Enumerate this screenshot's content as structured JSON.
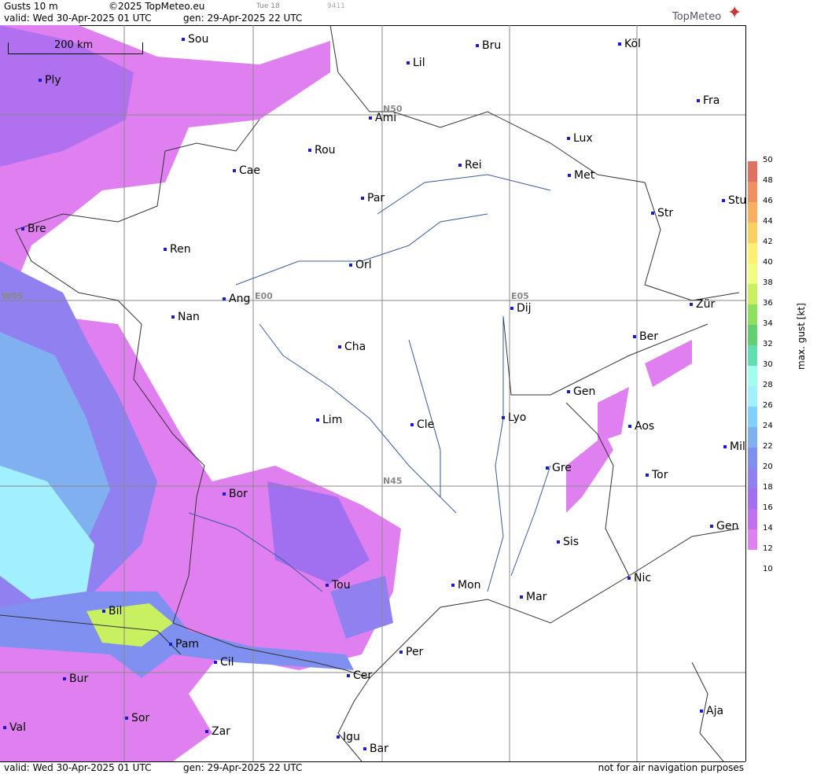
{
  "header": {
    "product": "Gusts 10 m",
    "copyright": "©2025 TopMeteo.eu",
    "model_run_tag": "Tue 18",
    "code": "9411",
    "valid": "valid:  Wed  30-Apr-2025  01 UTC",
    "gen": "gen:  29-Apr-2025  22 UTC",
    "logo_text": "TopMeteo"
  },
  "scale_bar": {
    "label": "200 km"
  },
  "grid_labels": [
    "N50",
    "W05",
    "E00",
    "E05",
    "N45"
  ],
  "cities": [
    "Sou",
    "Bru",
    "Köl",
    "Lil",
    "Ply",
    "Ami",
    "Fra",
    "Lux",
    "Rou",
    "Cae",
    "Rei",
    "Met",
    "Par",
    "Stu",
    "Bre",
    "Str",
    "Ren",
    "Orl",
    "Ang",
    "Dij",
    "Zür",
    "Nan",
    "Ber",
    "Cha",
    "Gen",
    "Lim",
    "Cle",
    "Lyo",
    "Aos",
    "Mil",
    "Gre",
    "Tor",
    "Bor",
    "Gen",
    "Sis",
    "Nic",
    "Tou",
    "Mon",
    "Mar",
    "Bil",
    "Per",
    "Pam",
    "Cil",
    "Cer",
    "Bur",
    "Aja",
    "Sor",
    "Val",
    "Zar",
    "Igu",
    "Bar"
  ],
  "legend": {
    "title": "max. gust  [kt]",
    "ticks": [
      "50",
      "48",
      "46",
      "44",
      "42",
      "40",
      "38",
      "36",
      "34",
      "32",
      "30",
      "28",
      "26",
      "24",
      "22",
      "20",
      "18",
      "16",
      "14",
      "12",
      "10"
    ],
    "colors": [
      "#e07060",
      "#f09060",
      "#f8b060",
      "#fcd060",
      "#fff070",
      "#f0ff80",
      "#c8f060",
      "#90e060",
      "#60d070",
      "#60e0b0",
      "#a0fff0",
      "#a0f0ff",
      "#80d0ff",
      "#80b0f0",
      "#8090f0",
      "#9080f0",
      "#a070f0",
      "#c070f0",
      "#e080f0",
      "#ffffff"
    ]
  },
  "footer": {
    "valid": "valid:  Wed  30-Apr-2025  01 UTC",
    "gen": "gen:  29-Apr-2025  22 UTC",
    "disclaimer": "not for air navigation purposes"
  }
}
